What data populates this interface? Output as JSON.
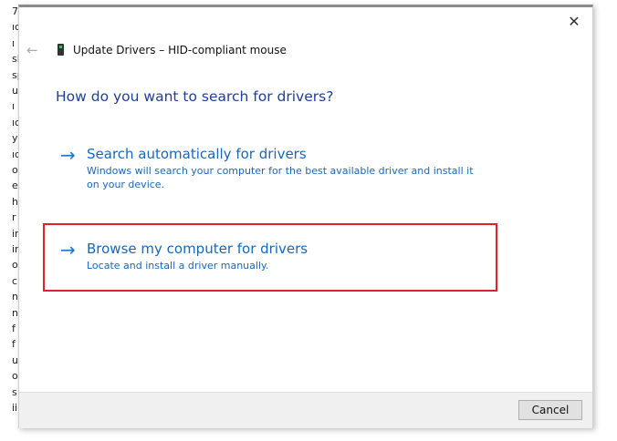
{
  "background_fragments": [
    "7",
    "ıc",
    "ı",
    "sl",
    "sp",
    "u",
    "ı",
    "ıc",
    "y",
    "ıc",
    "o",
    "et",
    "h",
    "r",
    "ir",
    "ir",
    "o",
    "c",
    "n",
    "n",
    "f",
    "f",
    "u",
    "o",
    "s",
    "ii"
  ],
  "dialog": {
    "title": "Update Drivers – HID-compliant mouse",
    "heading": "How do you want to search for drivers?",
    "close_glyph": "✕",
    "back_glyph": "←",
    "options": [
      {
        "arrow": "→",
        "title": "Search automatically for drivers",
        "description": "Windows will search your computer for the best available driver and install it on your device."
      },
      {
        "arrow": "→",
        "title": "Browse my computer for drivers",
        "description": "Locate and install a driver manually."
      }
    ],
    "cancel_label": "Cancel"
  },
  "colors": {
    "heading": "#1e3f9a",
    "link": "#1a67b8",
    "highlight": "#e0202c"
  }
}
